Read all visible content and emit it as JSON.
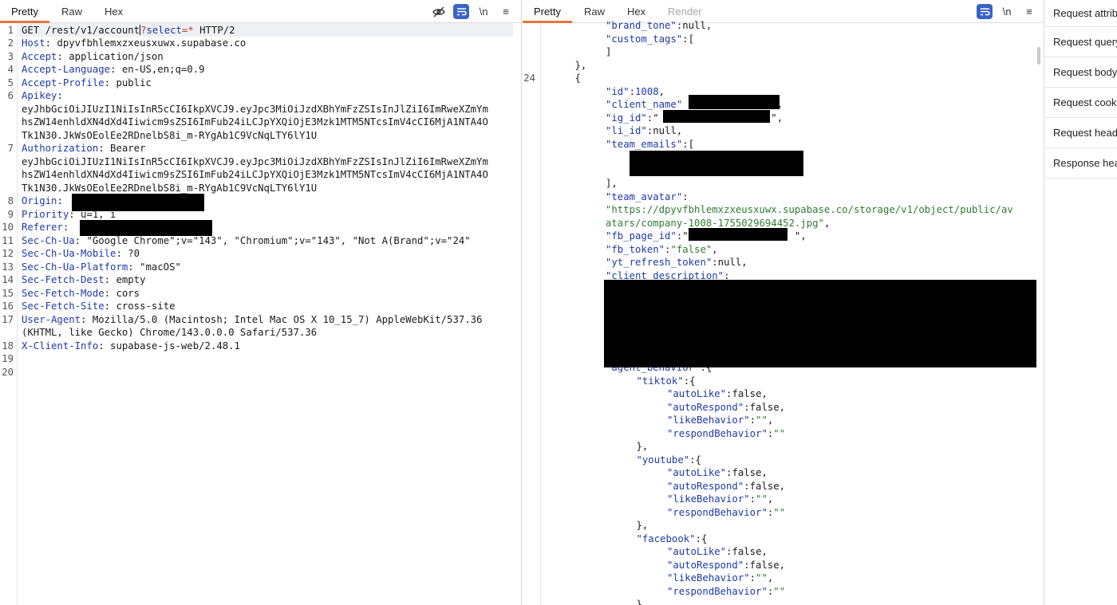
{
  "request": {
    "tabs": [
      "Pretty",
      "Raw",
      "Hex"
    ],
    "active_tab": "Pretty",
    "tool_newline": "\\n",
    "tool_menu": "≡",
    "lines": [
      {
        "n": "1",
        "parts": [
          {
            "t": "GET /rest/v1/account"
          },
          {
            "caret": true
          },
          {
            "t": "?",
            "c": "op"
          },
          {
            "t": "select",
            "c": "k"
          },
          {
            "t": "=",
            "c": "op"
          },
          {
            "t": "*",
            "c": "op"
          },
          {
            "t": " HTTP/2"
          }
        ]
      },
      {
        "n": "2",
        "parts": [
          {
            "t": "Host",
            "c": "k"
          },
          {
            "t": ": dpyvfbhlemxzxeusxuwx.supabase.co"
          }
        ]
      },
      {
        "n": "3",
        "parts": [
          {
            "t": "Accept",
            "c": "k"
          },
          {
            "t": ": application/json"
          }
        ]
      },
      {
        "n": "4",
        "parts": [
          {
            "t": "Accept-Language",
            "c": "k"
          },
          {
            "t": ": en-US,en;q=0.9"
          }
        ]
      },
      {
        "n": "5",
        "parts": [
          {
            "t": "Accept-Profile",
            "c": "k"
          },
          {
            "t": ": public"
          }
        ]
      },
      {
        "n": "6",
        "parts": [
          {
            "t": "Apikey",
            "c": "k"
          },
          {
            "t": ":"
          }
        ]
      },
      {
        "n": "",
        "parts": [
          {
            "t": "eyJhbGciOiJIUzI1NiIsInR5cCI6IkpXVCJ9.eyJpc3MiOiJzdXBhYmFzZSIsInJlZiI6ImRweXZmYm"
          }
        ]
      },
      {
        "n": "",
        "parts": [
          {
            "t": "hsZW14enhldXN4dXd4Iiwicm9sZSI6ImFub24iLCJpYXQiOjE3Mzk1MTM5NTcsImV4cCI6MjA1NTA4O"
          }
        ]
      },
      {
        "n": "",
        "parts": [
          {
            "t": "Tk1N30.JkWsOEolEe2RDnelbS8i_m-RYgAb1C9VcNqLTY6lY1U"
          }
        ]
      },
      {
        "n": "7",
        "parts": [
          {
            "t": "Authorization",
            "c": "k"
          },
          {
            "t": ": Bearer"
          }
        ]
      },
      {
        "n": "",
        "parts": [
          {
            "t": "eyJhbGciOiJIUzI1NiIsInR5cCI6IkpXVCJ9.eyJpc3MiOiJzdXBhYmFzZSIsInJlZiI6ImRweXZmYm"
          }
        ]
      },
      {
        "n": "",
        "parts": [
          {
            "t": "hsZW14enhldXN4dXd4Iiwicm9sZSI6ImFub24iLCJpYXQiOjE3Mzk1MTM5NTcsImV4cCI6MjA1NTA4O"
          }
        ]
      },
      {
        "n": "",
        "parts": [
          {
            "t": "Tk1N30.JkWsOEolEe2RDnelbS8i_m-RYgAb1C9VcNqLTY6lY1U"
          }
        ]
      },
      {
        "n": "8",
        "parts": [
          {
            "t": "Origin",
            "c": "k"
          },
          {
            "t": ":"
          }
        ]
      },
      {
        "n": "9",
        "parts": [
          {
            "t": "Priority",
            "c": "k"
          },
          {
            "t": ": u=1, i"
          }
        ]
      },
      {
        "n": "10",
        "parts": [
          {
            "t": "Referer",
            "c": "k"
          },
          {
            "t": ":"
          }
        ]
      },
      {
        "n": "11",
        "parts": [
          {
            "t": "Sec-Ch-Ua",
            "c": "k"
          },
          {
            "t": ": \"Google Chrome\";v=\"143\", \"Chromium\";v=\"143\", \"Not A(Brand\";v=\"24\""
          }
        ]
      },
      {
        "n": "12",
        "parts": [
          {
            "t": "Sec-Ch-Ua-Mobile",
            "c": "k"
          },
          {
            "t": ": ?0"
          }
        ]
      },
      {
        "n": "13",
        "parts": [
          {
            "t": "Sec-Ch-Ua-Platform",
            "c": "k"
          },
          {
            "t": ": \"macOS\""
          }
        ]
      },
      {
        "n": "14",
        "parts": [
          {
            "t": "Sec-Fetch-Dest",
            "c": "k"
          },
          {
            "t": ": empty"
          }
        ]
      },
      {
        "n": "15",
        "parts": [
          {
            "t": "Sec-Fetch-Mode",
            "c": "k"
          },
          {
            "t": ": cors"
          }
        ]
      },
      {
        "n": "16",
        "parts": [
          {
            "t": "Sec-Fetch-Site",
            "c": "k"
          },
          {
            "t": ": cross-site"
          }
        ]
      },
      {
        "n": "17",
        "parts": [
          {
            "t": "User-Agent",
            "c": "k"
          },
          {
            "t": ": Mozilla/5.0 (Macintosh; Intel Mac OS X 10_15_7) AppleWebKit/537.36"
          }
        ]
      },
      {
        "n": "",
        "parts": [
          {
            "t": "(KHTML, like Gecko) Chrome/143.0.0.0 Safari/537.36"
          }
        ]
      },
      {
        "n": "18",
        "parts": [
          {
            "t": "X-Client-Info",
            "c": "k"
          },
          {
            "t": ": supabase-js-web/2.48.1"
          }
        ]
      },
      {
        "n": "19",
        "parts": []
      },
      {
        "n": "20",
        "parts": []
      }
    ]
  },
  "response": {
    "tabs": [
      "Pretty",
      "Raw",
      "Hex",
      "Render"
    ],
    "active_tab": "Pretty",
    "tool_newline": "\\n",
    "tool_menu": "≡",
    "lines": [
      {
        "n": "",
        "i": 2,
        "parts": [
          {
            "t": "\"brand_tone\"",
            "c": "k"
          },
          {
            "t": ":null,"
          }
        ]
      },
      {
        "n": "",
        "i": 2,
        "parts": [
          {
            "t": "\"custom_tags\"",
            "c": "k"
          },
          {
            "t": ":["
          }
        ]
      },
      {
        "n": "",
        "i": 2,
        "parts": [
          {
            "t": "]"
          }
        ]
      },
      {
        "n": "",
        "i": 1,
        "parts": [
          {
            "t": "},"
          }
        ]
      },
      {
        "n": "24",
        "i": 1,
        "parts": [
          {
            "t": "{"
          }
        ]
      },
      {
        "n": "",
        "i": 2,
        "parts": [
          {
            "t": "\"id\"",
            "c": "k"
          },
          {
            "t": ":"
          },
          {
            "t": "1008",
            "c": "num"
          },
          {
            "t": ","
          }
        ]
      },
      {
        "n": "",
        "i": 2,
        "parts": [
          {
            "t": "\"client_name\"",
            "c": "k"
          },
          {
            "t": "                ,"
          }
        ]
      },
      {
        "n": "",
        "i": 2,
        "parts": [
          {
            "t": "\"ig_id\"",
            "c": "k"
          },
          {
            "t": ":\"                   \","
          }
        ]
      },
      {
        "n": "",
        "i": 2,
        "parts": [
          {
            "t": "\"li_id\"",
            "c": "k"
          },
          {
            "t": ":null,"
          }
        ]
      },
      {
        "n": "",
        "i": 2,
        "parts": [
          {
            "t": "\"team_emails\"",
            "c": "k"
          },
          {
            "t": ":["
          }
        ]
      },
      {
        "n": "",
        "i": 2,
        "parts": []
      },
      {
        "n": "",
        "i": 2,
        "parts": []
      },
      {
        "n": "",
        "i": 2,
        "parts": [
          {
            "t": "],"
          }
        ]
      },
      {
        "n": "",
        "i": 2,
        "parts": [
          {
            "t": "\"team_avatar\"",
            "c": "k"
          },
          {
            "t": ":"
          }
        ]
      },
      {
        "n": "",
        "i": 2,
        "parts": [
          {
            "t": "\"https://dpyvfbhlemxzxeusxuwx.supabase.co/storage/v1/object/public/av",
            "c": "str"
          }
        ]
      },
      {
        "n": "",
        "i": 2,
        "parts": [
          {
            "t": "atars/company-1008-1755029694452.jpg\"",
            "c": "str"
          },
          {
            "t": ","
          }
        ]
      },
      {
        "n": "",
        "i": 2,
        "parts": [
          {
            "t": "\"fb_page_id\"",
            "c": "k"
          },
          {
            "t": ":\"                  \","
          }
        ]
      },
      {
        "n": "",
        "i": 2,
        "parts": [
          {
            "t": "\"fb_token\"",
            "c": "k"
          },
          {
            "t": ":"
          },
          {
            "t": "\"false\"",
            "c": "str"
          },
          {
            "t": ","
          }
        ]
      },
      {
        "n": "",
        "i": 2,
        "parts": [
          {
            "t": "\"yt_refresh_token\"",
            "c": "k"
          },
          {
            "t": ":null,"
          }
        ]
      },
      {
        "n": "",
        "i": 2,
        "parts": [
          {
            "t": "\"client_description\"",
            "c": "k"
          },
          {
            "t": ":"
          }
        ]
      },
      {
        "n": "",
        "i": 2,
        "parts": []
      },
      {
        "n": "",
        "i": 2,
        "parts": []
      },
      {
        "n": "",
        "i": 2,
        "parts": []
      },
      {
        "n": "",
        "i": 2,
        "parts": []
      },
      {
        "n": "",
        "i": 2,
        "parts": []
      },
      {
        "n": "",
        "i": 2,
        "parts": []
      },
      {
        "n": "",
        "i": 2,
        "parts": [
          {
            "t": "\"agent_behavior\"",
            "c": "k"
          },
          {
            "t": ":{"
          }
        ]
      },
      {
        "n": "",
        "i": 3,
        "parts": [
          {
            "t": "\"tiktok\"",
            "c": "k"
          },
          {
            "t": ":{"
          }
        ]
      },
      {
        "n": "",
        "i": 4,
        "parts": [
          {
            "t": "\"autoLike\"",
            "c": "k"
          },
          {
            "t": ":false,"
          }
        ]
      },
      {
        "n": "",
        "i": 4,
        "parts": [
          {
            "t": "\"autoRespond\"",
            "c": "k"
          },
          {
            "t": ":false,"
          }
        ]
      },
      {
        "n": "",
        "i": 4,
        "parts": [
          {
            "t": "\"likeBehavior\"",
            "c": "k"
          },
          {
            "t": ":"
          },
          {
            "t": "\"\"",
            "c": "str"
          },
          {
            "t": ","
          }
        ]
      },
      {
        "n": "",
        "i": 4,
        "parts": [
          {
            "t": "\"respondBehavior\"",
            "c": "k"
          },
          {
            "t": ":"
          },
          {
            "t": "\"\"",
            "c": "str"
          }
        ]
      },
      {
        "n": "",
        "i": 3,
        "parts": [
          {
            "t": "},"
          }
        ]
      },
      {
        "n": "",
        "i": 3,
        "parts": [
          {
            "t": "\"youtube\"",
            "c": "k"
          },
          {
            "t": ":{"
          }
        ]
      },
      {
        "n": "",
        "i": 4,
        "parts": [
          {
            "t": "\"autoLike\"",
            "c": "k"
          },
          {
            "t": ":false,"
          }
        ]
      },
      {
        "n": "",
        "i": 4,
        "parts": [
          {
            "t": "\"autoRespond\"",
            "c": "k"
          },
          {
            "t": ":false,"
          }
        ]
      },
      {
        "n": "",
        "i": 4,
        "parts": [
          {
            "t": "\"likeBehavior\"",
            "c": "k"
          },
          {
            "t": ":"
          },
          {
            "t": "\"\"",
            "c": "str"
          },
          {
            "t": ","
          }
        ]
      },
      {
        "n": "",
        "i": 4,
        "parts": [
          {
            "t": "\"respondBehavior\"",
            "c": "k"
          },
          {
            "t": ":"
          },
          {
            "t": "\"\"",
            "c": "str"
          }
        ]
      },
      {
        "n": "",
        "i": 3,
        "parts": [
          {
            "t": "},"
          }
        ]
      },
      {
        "n": "",
        "i": 3,
        "parts": [
          {
            "t": "\"facebook\"",
            "c": "k"
          },
          {
            "t": ":{"
          }
        ]
      },
      {
        "n": "",
        "i": 4,
        "parts": [
          {
            "t": "\"autoLike\"",
            "c": "k"
          },
          {
            "t": ":false,"
          }
        ]
      },
      {
        "n": "",
        "i": 4,
        "parts": [
          {
            "t": "\"autoRespond\"",
            "c": "k"
          },
          {
            "t": ":false,"
          }
        ]
      },
      {
        "n": "",
        "i": 4,
        "parts": [
          {
            "t": "\"likeBehavior\"",
            "c": "k"
          },
          {
            "t": ":"
          },
          {
            "t": "\"\"",
            "c": "str"
          },
          {
            "t": ","
          }
        ]
      },
      {
        "n": "",
        "i": 4,
        "parts": [
          {
            "t": "\"respondBehavior\"",
            "c": "k"
          },
          {
            "t": ":"
          },
          {
            "t": "\"\"",
            "c": "str"
          }
        ]
      },
      {
        "n": "",
        "i": 3,
        "parts": [
          {
            "t": "},"
          }
        ]
      }
    ]
  },
  "inspector": {
    "items": [
      "Request attributes",
      "Request query parameters",
      "Request body parameters",
      "Request cookies",
      "Request headers",
      "Response headers"
    ]
  },
  "colors": {
    "key_blue": "#1e3aa8",
    "string_green": "#2e7d32",
    "operator_red": "#c0392b",
    "tab_accent": "#e8743b",
    "toggle_blue": "#3a63c7"
  }
}
